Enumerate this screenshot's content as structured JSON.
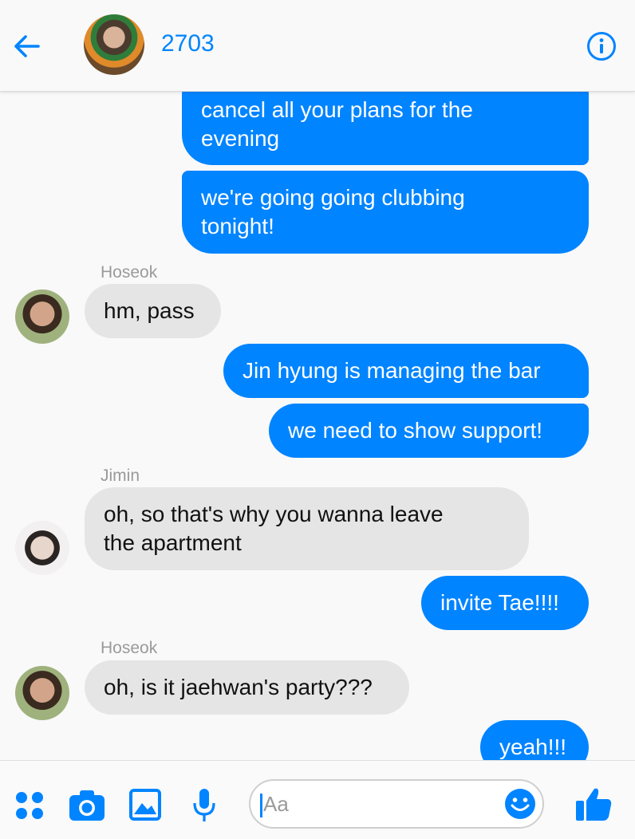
{
  "header": {
    "back_icon": "arrow-left-icon",
    "title": "2703",
    "info_icon": "info-circle-icon",
    "accent_color": "#0084ff"
  },
  "messages": [
    {
      "direction": "out",
      "text": "cancel all your plans for the\nevening"
    },
    {
      "direction": "out",
      "text": "we're going going clubbing\ntonight!"
    },
    {
      "direction": "in",
      "sender": "Hoseok",
      "text": "hm, pass"
    },
    {
      "direction": "out",
      "text": "Jin hyung is managing the bar"
    },
    {
      "direction": "out",
      "text": "we need to show support!"
    },
    {
      "direction": "in",
      "sender": "Jimin",
      "text": "oh, so that's why you wanna leave\nthe apartment"
    },
    {
      "direction": "out",
      "text": "invite Tae!!!!"
    },
    {
      "direction": "in",
      "sender": "Hoseok",
      "text": "oh, is it jaehwan's party???"
    },
    {
      "direction": "out",
      "text": "yeah!!!"
    }
  ],
  "composer": {
    "placeholder": "Aa",
    "icons": [
      "apps-grid-icon",
      "camera-icon",
      "image-icon",
      "microphone-icon",
      "emoji-icon",
      "thumbs-up-icon"
    ]
  },
  "colors": {
    "outgoing_bubble": "#0084ff",
    "incoming_bubble": "#e5e5e5"
  }
}
